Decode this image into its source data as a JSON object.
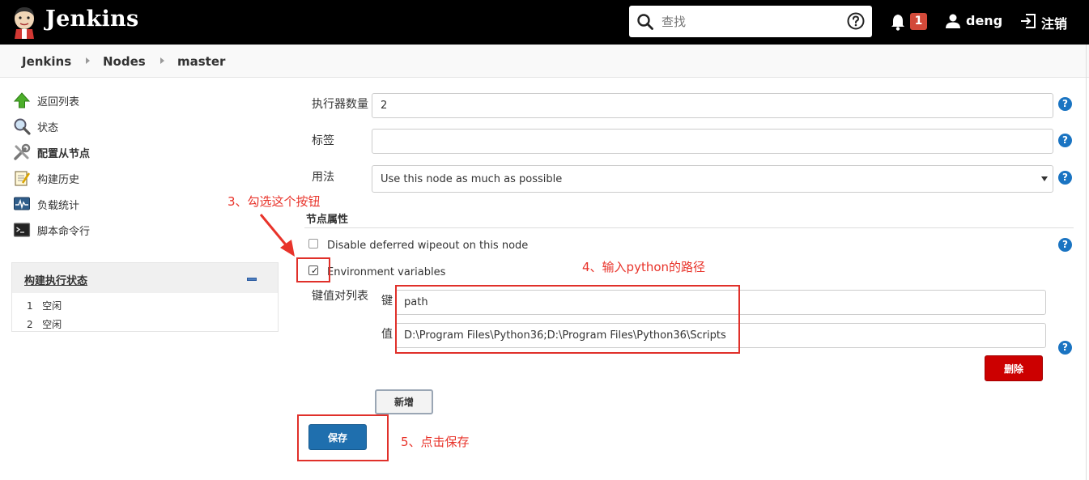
{
  "header": {
    "brand": "Jenkins",
    "search_placeholder": "查找",
    "notification_count": "1",
    "user_name": "deng",
    "logout_label": "注销"
  },
  "breadcrumb": [
    "Jenkins",
    "Nodes",
    "master"
  ],
  "sidebar": {
    "items": [
      {
        "label": "返回列表",
        "icon": "up-arrow-icon"
      },
      {
        "label": "状态",
        "icon": "magnifier-icon"
      },
      {
        "label": "配置从节点",
        "icon": "tools-icon"
      },
      {
        "label": "构建历史",
        "icon": "notepad-icon"
      },
      {
        "label": "负载统计",
        "icon": "monitor-graph-icon"
      },
      {
        "label": "脚本命令行",
        "icon": "terminal-icon"
      }
    ],
    "executor_panel": {
      "title": "构建执行状态",
      "rows": [
        {
          "num": "1",
          "status": "空闲"
        },
        {
          "num": "2",
          "status": "空闲"
        }
      ]
    }
  },
  "form": {
    "executors_label": "执行器数量",
    "executors_value": "2",
    "labels_label": "标签",
    "labels_value": "",
    "usage_label": "用法",
    "usage_value": "Use this node as much as possible",
    "node_properties_title": "节点属性",
    "disable_wipeout_label": "Disable deferred wipeout on this node",
    "env_vars_label": "Environment variables",
    "kv_list_label": "键值对列表",
    "key_label": "键",
    "key_value": "path",
    "value_label": "值",
    "value_value": "D:\\Program Files\\Python36;D:\\Program Files\\Python36\\Scripts",
    "delete_label": "删除",
    "add_label": "新增",
    "save_label": "保存"
  },
  "annotations": {
    "step3": "3、勾选这个按钮",
    "step4": "4、输入python的路径",
    "step5": "5、点击保存"
  },
  "colors": {
    "header_bg": "#000000",
    "badge": "#d24939",
    "help_blue": "#1a74c2",
    "save_button": "#1f6fae",
    "delete_button": "#cc0000",
    "annotation_red": "#e8332a"
  }
}
